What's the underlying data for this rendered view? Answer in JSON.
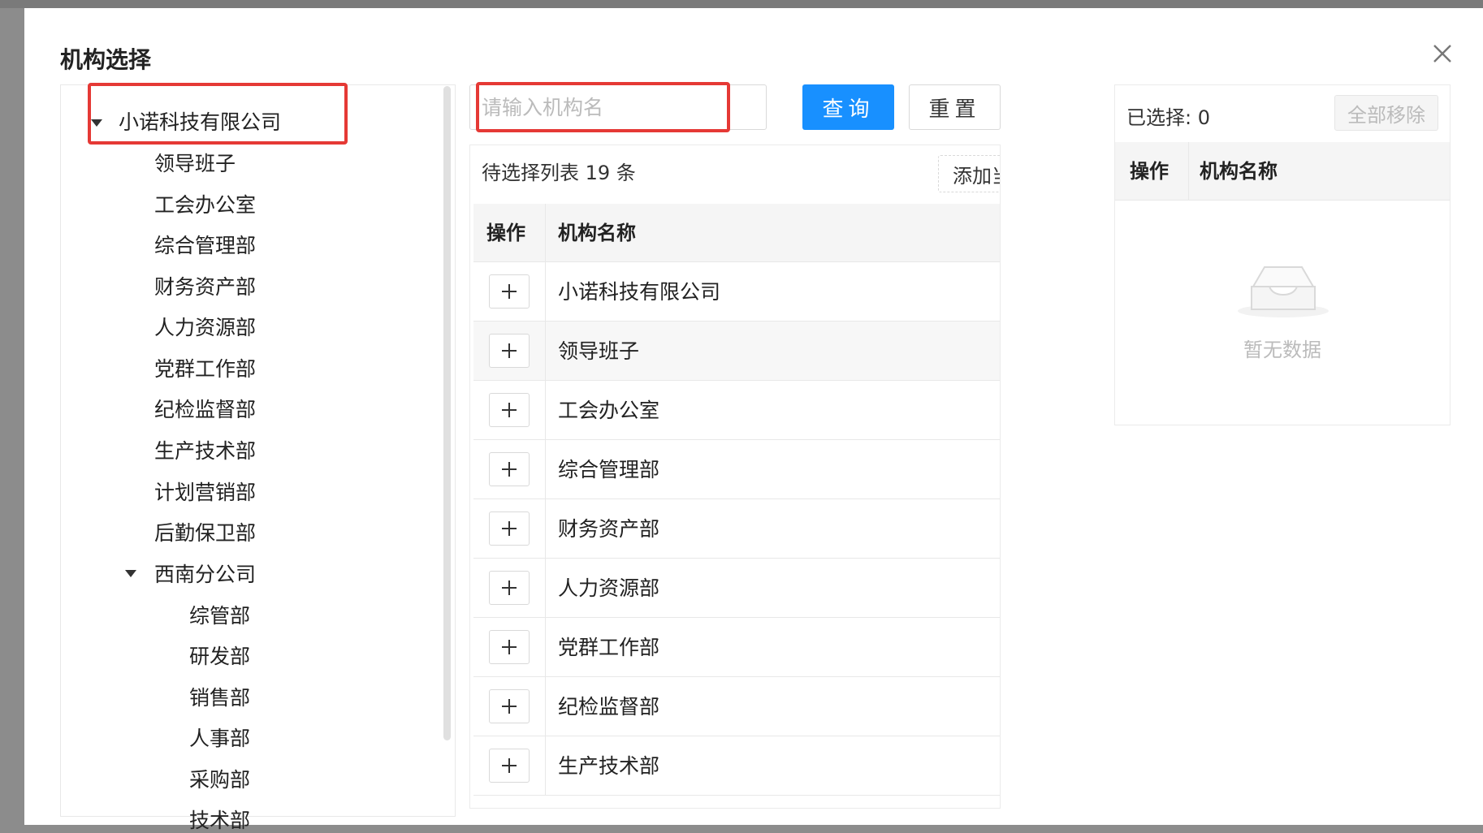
{
  "modal": {
    "title": "机构选择"
  },
  "tree": {
    "root": "小诺科技有限公司",
    "children": [
      "领导班子",
      "工会办公室",
      "综合管理部",
      "财务资产部",
      "人力资源部",
      "党群工作部",
      "纪检监督部",
      "生产技术部",
      "计划营销部",
      "后勤保卫部"
    ],
    "branch": {
      "label": "西南分公司",
      "children": [
        "综管部",
        "研发部",
        "销售部",
        "人事部",
        "采购部",
        "技术部"
      ]
    }
  },
  "search": {
    "placeholder": "请输入机构名",
    "query_label": "查询",
    "reset_label": "重置"
  },
  "candidate_list": {
    "header": "待选择列表 19 条",
    "add_current_label": "添加当前数据",
    "columns": [
      "操作",
      "机构名称"
    ],
    "rows": [
      "小诺科技有限公司",
      "领导班子",
      "工会办公室",
      "综合管理部",
      "财务资产部",
      "人力资源部",
      "党群工作部",
      "纪检监督部",
      "生产技术部"
    ]
  },
  "selected": {
    "count_label": "已选择: 0",
    "remove_all_label": "全部移除",
    "columns": [
      "操作",
      "机构名称"
    ],
    "empty_text": "暂无数据"
  },
  "colors": {
    "primary": "#1890ff",
    "highlight": "#e53935"
  },
  "icons": {
    "close": "close-icon",
    "add": "plus-icon",
    "expand": "caret-down-icon",
    "empty": "empty-inbox-icon"
  }
}
